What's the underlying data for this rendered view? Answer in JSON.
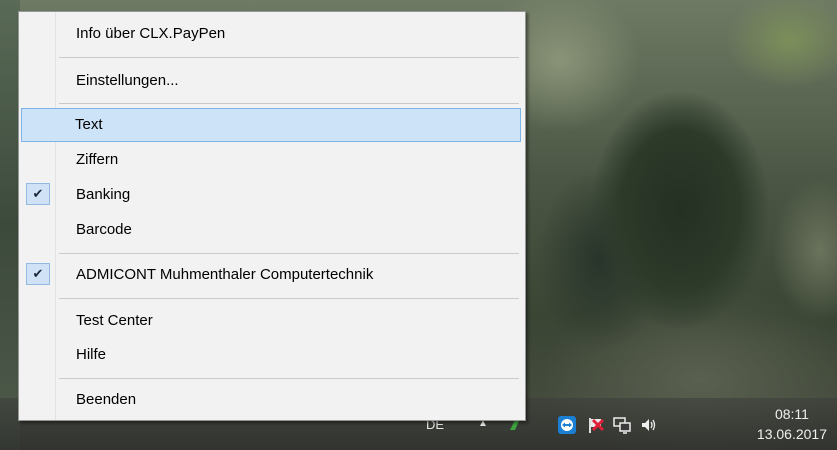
{
  "menu": {
    "items": [
      {
        "label": "Info über CLX.PayPen",
        "checked": false
      },
      {
        "label": "Einstellungen...",
        "checked": false
      },
      {
        "label": "Text",
        "checked": false,
        "highlighted": true
      },
      {
        "label": "Ziffern",
        "checked": false
      },
      {
        "label": "Banking",
        "checked": true
      },
      {
        "label": "Barcode",
        "checked": false
      },
      {
        "label": "ADMICONT Muhmenthaler Computertechnik",
        "checked": true
      },
      {
        "label": "Test Center",
        "checked": false
      },
      {
        "label": "Hilfe",
        "checked": false
      },
      {
        "label": "Beenden",
        "checked": false
      }
    ],
    "check_glyph": "✔"
  },
  "taskbar": {
    "language": "DE",
    "overflow_chevron": "▲",
    "time": "08:11",
    "date": "13.06.2017",
    "tray_icons": [
      "app-icon",
      "teamviewer-icon",
      "flag-icon",
      "network-icon",
      "volume-icon"
    ]
  },
  "colors": {
    "menu_bg": "#f2f2f2",
    "highlight_bg": "#cde3f7",
    "highlight_border": "#7eb4ea",
    "check_bg": "#cfe2f6"
  }
}
